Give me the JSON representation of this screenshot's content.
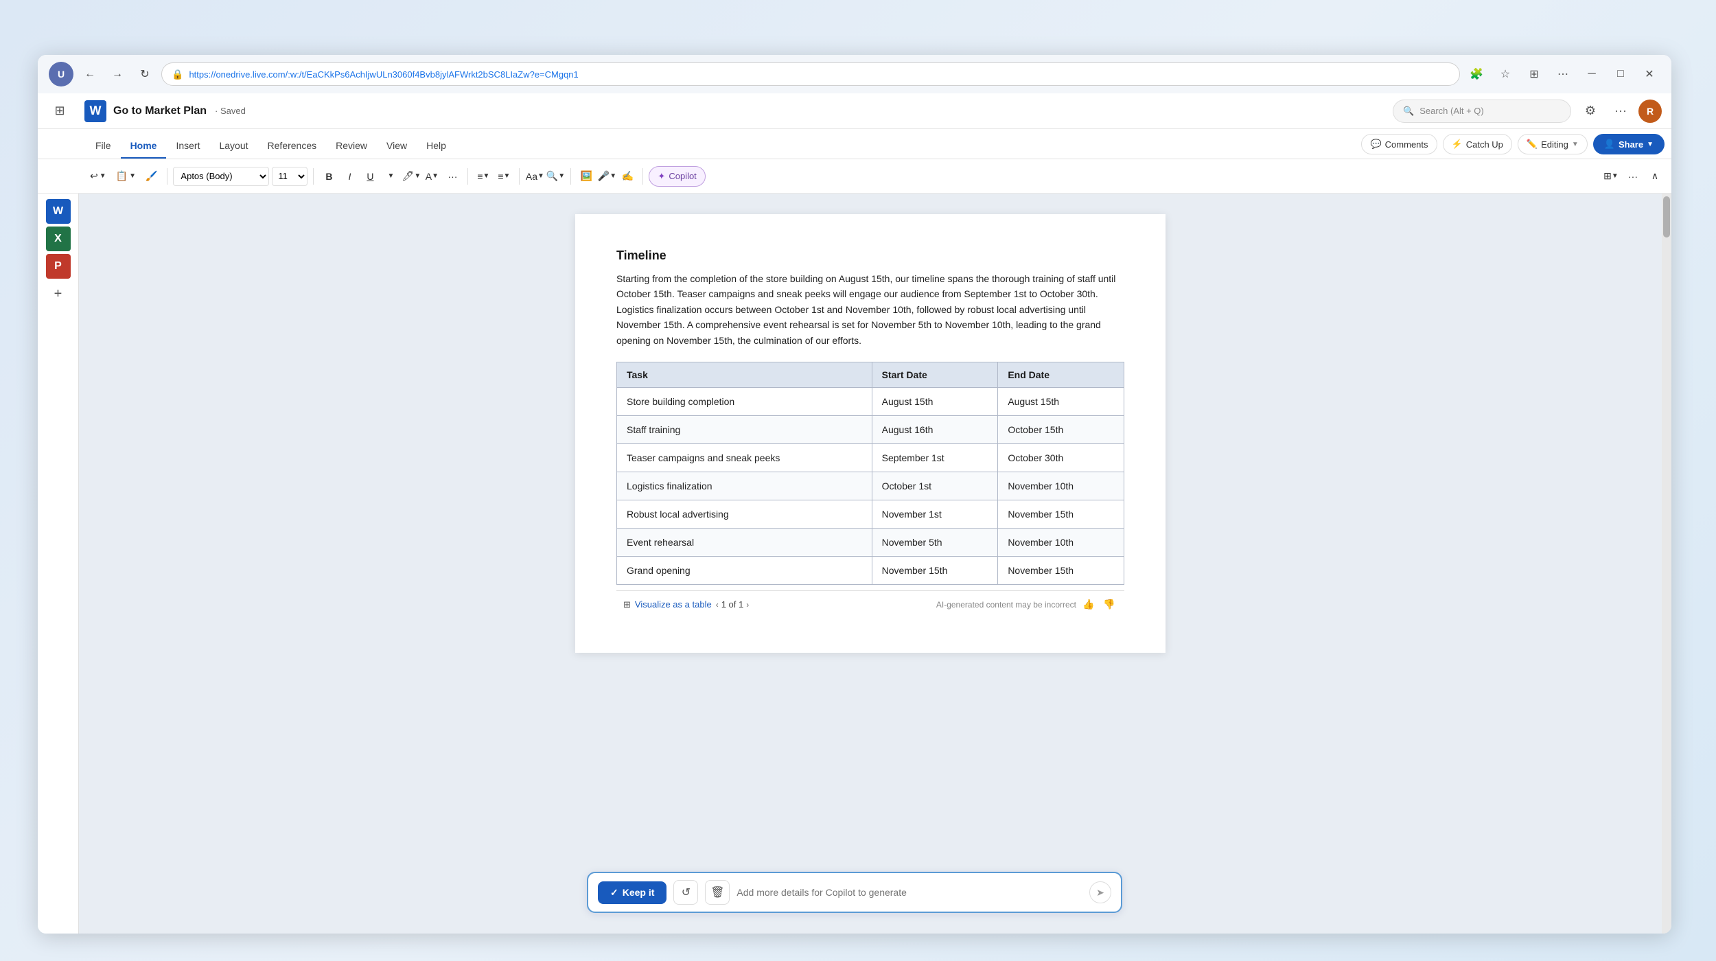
{
  "browser": {
    "url": "https://onedrive.live.com/:w:/t/EaCKkPs6AchIjwULn3060f4Bvb8jylAFWrkt2bSC8LIaZw?e=CMgqn1",
    "avatar_initials": "U"
  },
  "app": {
    "word_logo": "W",
    "doc_title": "Go to Market Plan",
    "saved_label": "· Saved",
    "search_placeholder": "Search (Alt + Q)",
    "settings_icon": "⚙",
    "more_icon": "···",
    "user_initials": "R"
  },
  "ribbon": {
    "tabs": [
      {
        "label": "File",
        "active": false
      },
      {
        "label": "Home",
        "active": true
      },
      {
        "label": "Insert",
        "active": false
      },
      {
        "label": "Layout",
        "active": false
      },
      {
        "label": "References",
        "active": false
      },
      {
        "label": "Review",
        "active": false
      },
      {
        "label": "View",
        "active": false
      },
      {
        "label": "Help",
        "active": false
      }
    ],
    "comments_label": "Comments",
    "catchup_label": "Catch Up",
    "editing_label": "Editing",
    "share_label": "Share"
  },
  "toolbar": {
    "font_name": "Aptos (Body)",
    "font_size": "11",
    "bold_label": "B",
    "italic_label": "I",
    "underline_label": "U",
    "copilot_label": "Copilot"
  },
  "document": {
    "timeline_heading": "Timeline",
    "timeline_paragraph": "Starting from the completion of the store building on August 15th, our timeline spans the thorough training of staff until October 15th. Teaser campaigns and sneak peeks will engage our audience from September 1st to October 30th. Logistics finalization occurs between October 1st and November 10th, followed by robust local advertising until November 15th. A comprehensive event rehearsal is set for November 5th to November 10th, leading to the grand opening on November 15th, the culmination of our efforts.",
    "table": {
      "headers": [
        "Task",
        "Start Date",
        "End Date"
      ],
      "rows": [
        {
          "task": "Store building completion",
          "start": "August 15th",
          "end": "August 15th"
        },
        {
          "task": "Staff training",
          "start": "August 16th",
          "end": "October 15th"
        },
        {
          "task": "Teaser campaigns and sneak peeks",
          "start": "September 1st",
          "end": "October 30th"
        },
        {
          "task": "Logistics finalization",
          "start": "October 1st",
          "end": "November 10th"
        },
        {
          "task": "Robust local advertising",
          "start": "November 1st",
          "end": "November 15th"
        },
        {
          "task": "Event rehearsal",
          "start": "November 5th",
          "end": "November 10th"
        },
        {
          "task": "Grand opening",
          "start": "November 15th",
          "end": "November 15th"
        }
      ]
    }
  },
  "copilot_bar": {
    "keep_it_label": "Keep it",
    "input_placeholder": "Add more details for Copilot to generate",
    "visualize_label": "Visualize as a table",
    "page_info": "1 of 1",
    "ai_label": "AI-generated content may be incorrect"
  },
  "left_sidebar": {
    "icons": [
      "⊞",
      "W",
      "X",
      "P",
      "+"
    ]
  }
}
